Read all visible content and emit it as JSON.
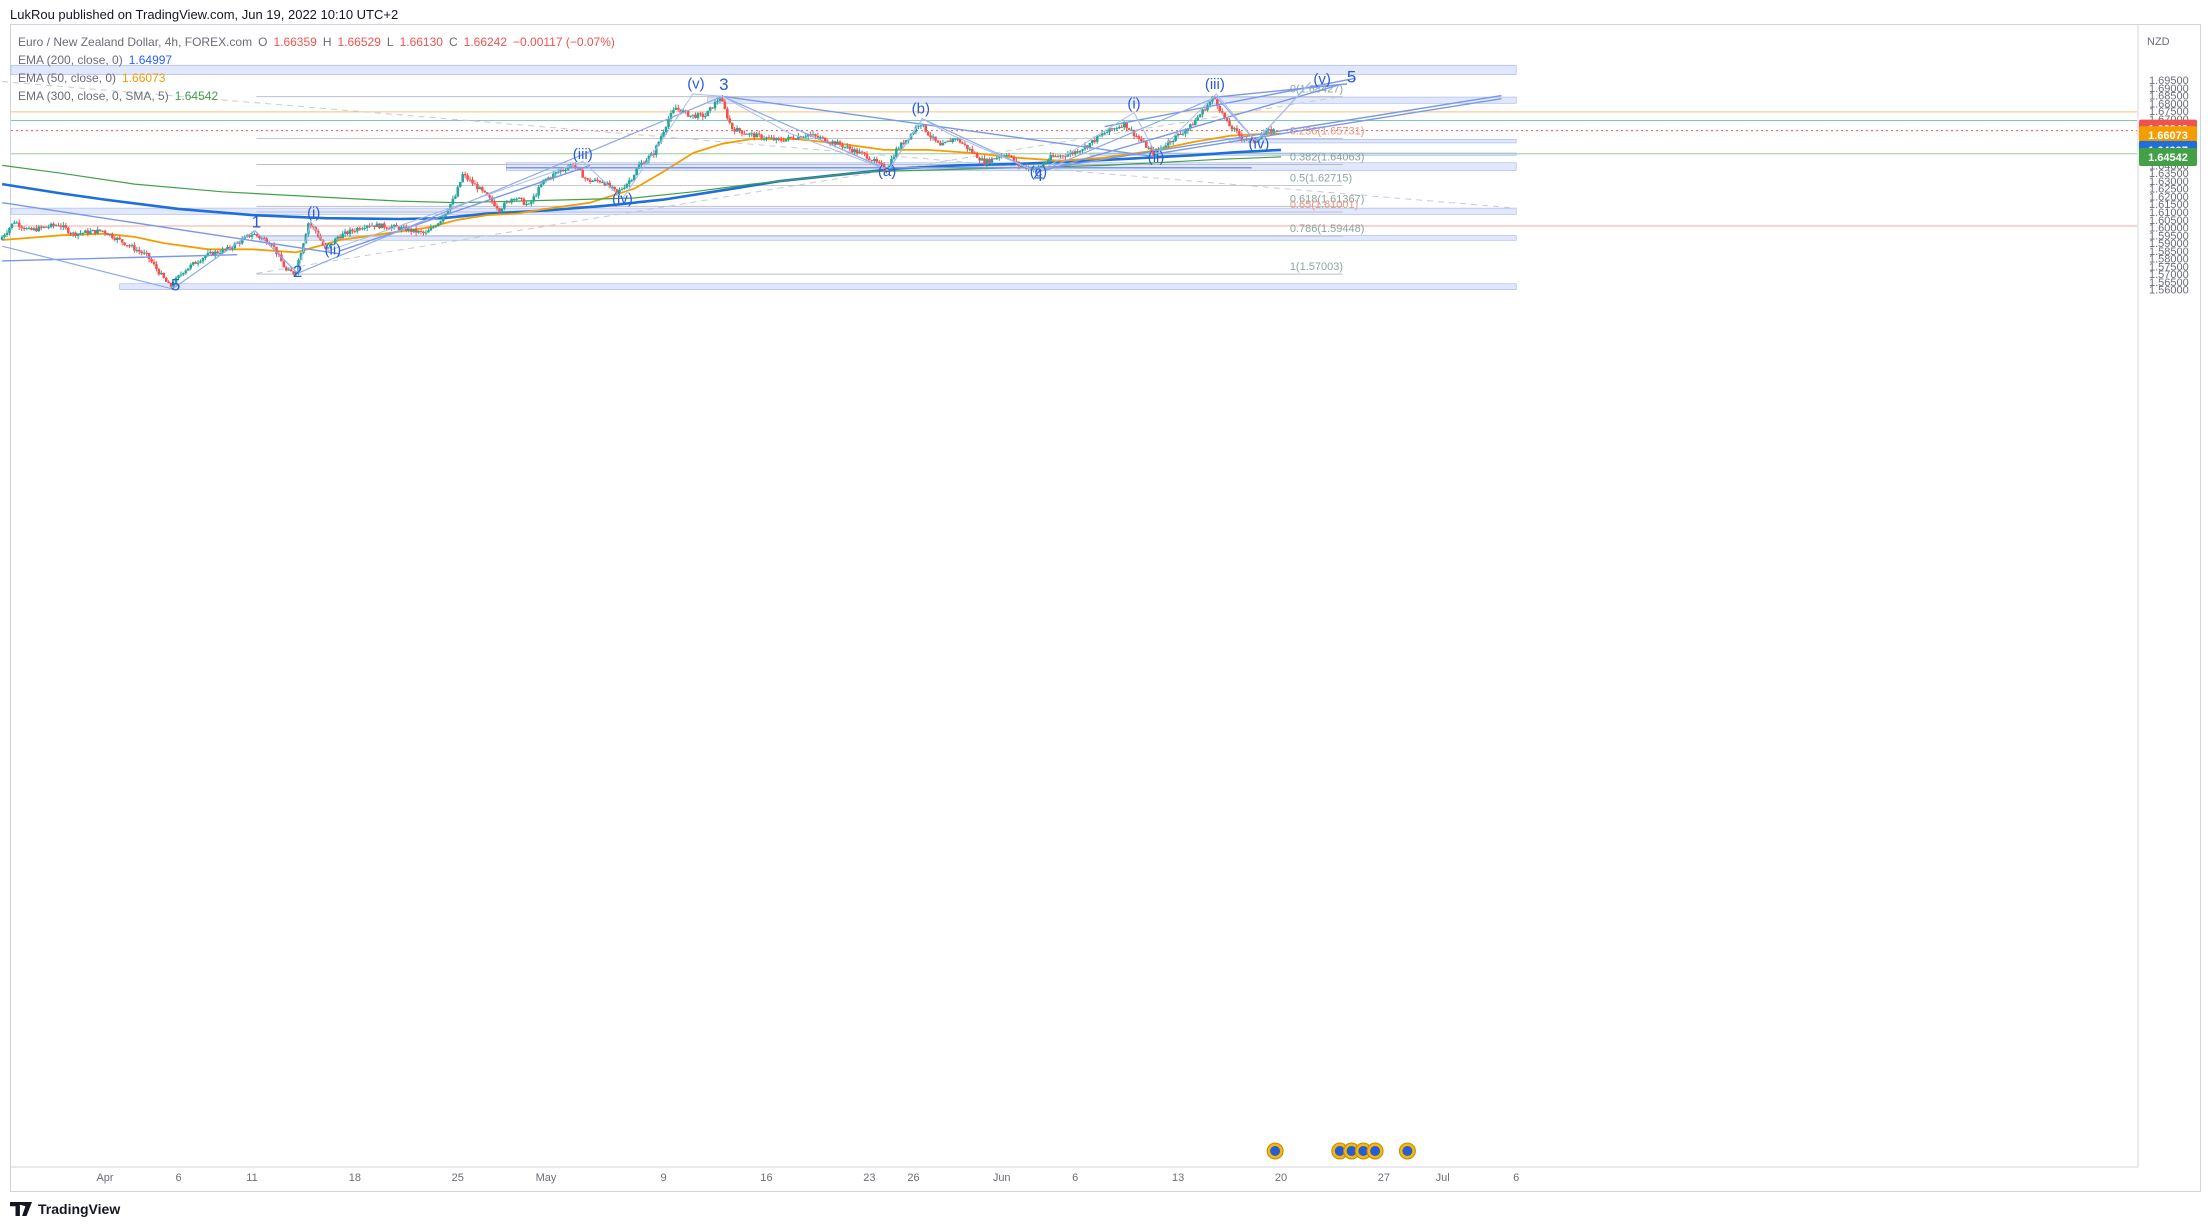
{
  "header": {
    "publisher": "LukRou published on TradingView.com, Jun 19, 2022 10:10 UTC+2"
  },
  "legend": {
    "title": "Euro / New Zealand Dollar, 4h, FOREX.com",
    "ohlc": {
      "o_label": "O",
      "o": "1.66359",
      "h_label": "H",
      "h": "1.66529",
      "l_label": "L",
      "l": "1.66130",
      "c_label": "C",
      "c": "1.66242",
      "change": "−0.00117 (−0.07%)"
    },
    "indicators": [
      {
        "label": "EMA (200, close, 0)",
        "value": "1.64997"
      },
      {
        "label": "EMA (50, close, 0)",
        "value": "1.66073"
      },
      {
        "label": "EMA (300, close, 0, SMA, 5)",
        "value": "1.64542"
      }
    ]
  },
  "footer": {
    "brand": "TradingView"
  },
  "colors": {
    "up": "#26a69a",
    "down": "#ef5350",
    "ema200": "#1e6fd9",
    "ema50": "#f59d00",
    "ema300": "#43a047",
    "zone": "#c9d6fb",
    "wave": "#2a5bd7",
    "trend": "#7a98e8"
  },
  "chart_data": {
    "type": "candlestick",
    "symbol": "Euro / New Zealand Dollar",
    "timeframe": "4h",
    "currency_label": "NZD",
    "ylim": [
      1.5575,
      1.7055
    ],
    "y_ticks": [
      "1.56000",
      "1.56500",
      "1.57000",
      "1.57500",
      "1.58000",
      "1.58500",
      "1.59000",
      "1.59500",
      "1.60000",
      "1.60500",
      "1.61000",
      "1.61500",
      "1.62000",
      "1.62500",
      "1.63000",
      "1.63500",
      "1.64000",
      "1.64500",
      "1.65000",
      "1.65500",
      "1.66000",
      "1.66500",
      "1.67000",
      "1.67500",
      "1.68000",
      "1.68500",
      "1.69000",
      "1.69500"
    ],
    "x_ticks": [
      {
        "label": "Apr",
        "d": 0
      },
      {
        "label": "6",
        "d": 5
      },
      {
        "label": "11",
        "d": 10
      },
      {
        "label": "18",
        "d": 17
      },
      {
        "label": "25",
        "d": 24
      },
      {
        "label": "May",
        "d": 30
      },
      {
        "label": "9",
        "d": 38
      },
      {
        "label": "16",
        "d": 45
      },
      {
        "label": "23",
        "d": 52
      },
      {
        "label": "26",
        "d": 55
      },
      {
        "label": "Jun",
        "d": 61
      },
      {
        "label": "6",
        "d": 66
      },
      {
        "label": "13",
        "d": 73
      },
      {
        "label": "20",
        "d": 80
      },
      {
        "label": "27",
        "d": 87
      },
      {
        "label": "Jul",
        "d": 91
      },
      {
        "label": "6",
        "d": 96
      }
    ],
    "price_path": [
      [
        -7,
        1.592
      ],
      [
        -6,
        1.604
      ],
      [
        -5,
        1.598
      ],
      [
        -3,
        1.602
      ],
      [
        -2,
        1.596
      ],
      [
        0,
        1.598
      ],
      [
        3,
        1.582
      ],
      [
        4.6,
        1.5615
      ],
      [
        5.5,
        1.572
      ],
      [
        7,
        1.582
      ],
      [
        8.5,
        1.586
      ],
      [
        10.2,
        1.596
      ],
      [
        11.5,
        1.59
      ],
      [
        12.5,
        1.572
      ],
      [
        13.1,
        1.5705
      ],
      [
        14,
        1.603
      ],
      [
        14.5,
        1.598
      ],
      [
        15.2,
        1.585
      ],
      [
        16,
        1.594
      ],
      [
        18,
        1.602
      ],
      [
        20,
        1.6
      ],
      [
        22,
        1.596
      ],
      [
        23,
        1.605
      ],
      [
        24,
        1.62
      ],
      [
        24.5,
        1.634
      ],
      [
        25.5,
        1.626
      ],
      [
        27,
        1.612
      ],
      [
        28,
        1.62
      ],
      [
        29,
        1.614
      ],
      [
        30,
        1.63
      ],
      [
        31,
        1.636
      ],
      [
        32,
        1.641
      ],
      [
        33,
        1.63
      ],
      [
        34,
        1.63
      ],
      [
        35,
        1.622
      ],
      [
        36,
        1.632
      ],
      [
        36.5,
        1.64
      ],
      [
        37.5,
        1.648
      ],
      [
        38.5,
        1.67
      ],
      [
        39,
        1.677
      ],
      [
        40,
        1.672
      ],
      [
        41,
        1.672
      ],
      [
        42,
        1.684
      ],
      [
        42.8,
        1.664
      ],
      [
        44,
        1.66
      ],
      [
        46,
        1.656
      ],
      [
        48,
        1.66
      ],
      [
        50,
        1.654
      ],
      [
        52,
        1.646
      ],
      [
        53.3,
        1.6372
      ],
      [
        54,
        1.65
      ],
      [
        55,
        1.66
      ],
      [
        55.6,
        1.668
      ],
      [
        56.2,
        1.66
      ],
      [
        57,
        1.652
      ],
      [
        58,
        1.658
      ],
      [
        59,
        1.65
      ],
      [
        60,
        1.642
      ],
      [
        61.5,
        1.648
      ],
      [
        62.3,
        1.64
      ],
      [
        63.5,
        1.6375
      ],
      [
        64.5,
        1.645
      ],
      [
        66,
        1.648
      ],
      [
        67,
        1.653
      ],
      [
        68,
        1.66
      ],
      [
        69.5,
        1.667
      ],
      [
        70,
        1.662
      ],
      [
        71.5,
        1.6475
      ],
      [
        72.5,
        1.655
      ],
      [
        74,
        1.665
      ],
      [
        75,
        1.677
      ],
      [
        75.6,
        1.684
      ],
      [
        76.5,
        1.667
      ],
      [
        77.5,
        1.658
      ],
      [
        78.3,
        1.6555
      ],
      [
        79,
        1.661
      ],
      [
        79.6,
        1.6624
      ]
    ],
    "series": [
      {
        "name": "EMA (200, close, 0)",
        "last": 1.64997,
        "points": [
          [
            -7,
            1.628
          ],
          [
            -3,
            1.622
          ],
          [
            0,
            1.618
          ],
          [
            5,
            1.612
          ],
          [
            10,
            1.608
          ],
          [
            15,
            1.606
          ],
          [
            20,
            1.6055
          ],
          [
            23,
            1.606
          ],
          [
            26,
            1.609
          ],
          [
            30,
            1.611
          ],
          [
            34,
            1.614
          ],
          [
            38,
            1.618
          ],
          [
            42,
            1.624
          ],
          [
            46,
            1.63
          ],
          [
            50,
            1.634
          ],
          [
            54,
            1.638
          ],
          [
            58,
            1.64
          ],
          [
            62,
            1.641
          ],
          [
            66,
            1.6425
          ],
          [
            70,
            1.6445
          ],
          [
            74,
            1.6465
          ],
          [
            77,
            1.6485
          ],
          [
            80,
            1.65
          ]
        ]
      },
      {
        "name": "EMA (50, close, 0)",
        "last": 1.66073,
        "points": [
          [
            -7,
            1.592
          ],
          [
            -3,
            1.595
          ],
          [
            0,
            1.596
          ],
          [
            2,
            1.594
          ],
          [
            4,
            1.59
          ],
          [
            7,
            1.586
          ],
          [
            10,
            1.586
          ],
          [
            13,
            1.584
          ],
          [
            16,
            1.592
          ],
          [
            19,
            1.596
          ],
          [
            22,
            1.6
          ],
          [
            24,
            1.605
          ],
          [
            26,
            1.608
          ],
          [
            28,
            1.609
          ],
          [
            30,
            1.612
          ],
          [
            33,
            1.616
          ],
          [
            36,
            1.625
          ],
          [
            38,
            1.636
          ],
          [
            40,
            1.648
          ],
          [
            42,
            1.654
          ],
          [
            44,
            1.657
          ],
          [
            47,
            1.657
          ],
          [
            50,
            1.654
          ],
          [
            53,
            1.65
          ],
          [
            56,
            1.65
          ],
          [
            59,
            1.648
          ],
          [
            62,
            1.645
          ],
          [
            65,
            1.643
          ],
          [
            68,
            1.645
          ],
          [
            71,
            1.649
          ],
          [
            74,
            1.655
          ],
          [
            76.5,
            1.659
          ],
          [
            78,
            1.66
          ],
          [
            80,
            1.6605
          ]
        ]
      },
      {
        "name": "EMA (300, close, 0, SMA, 5)",
        "last": 1.64542,
        "points": [
          [
            -7,
            1.64
          ],
          [
            -3,
            1.635
          ],
          [
            2,
            1.628
          ],
          [
            8,
            1.623
          ],
          [
            14,
            1.62
          ],
          [
            20,
            1.617
          ],
          [
            24,
            1.616
          ],
          [
            28,
            1.617
          ],
          [
            32,
            1.618
          ],
          [
            36,
            1.619
          ],
          [
            40,
            1.623
          ],
          [
            44,
            1.628
          ],
          [
            48,
            1.632
          ],
          [
            52,
            1.636
          ],
          [
            56,
            1.637
          ],
          [
            60,
            1.638
          ],
          [
            64,
            1.639
          ],
          [
            68,
            1.64
          ],
          [
            72,
            1.642
          ],
          [
            76,
            1.644
          ],
          [
            80,
            1.6455
          ]
        ]
      }
    ],
    "price_labels": [
      {
        "value": "1.66242",
        "y": 1.66242,
        "color": "#ef5350"
      },
      {
        "value": "1.66073",
        "y": 1.66073,
        "color": "#f59d00"
      },
      {
        "value": "1.64997",
        "y": 1.64997,
        "color": "#1e6fd9"
      },
      {
        "value": "1.64542",
        "y": 1.64542,
        "color": "#43a047"
      }
    ],
    "fib_levels": [
      {
        "label": "0(1.68427)",
        "y": 1.68427
      },
      {
        "label": "0.236(1.65731)",
        "y": 1.65731
      },
      {
        "label": "0.382(1.64063)",
        "y": 1.64063
      },
      {
        "label": "0.5(1.62715)",
        "y": 1.62715
      },
      {
        "label": "0.618(1.61367)",
        "y": 1.61367
      },
      {
        "label": "0.65(1.61001)",
        "y": 1.61001
      },
      {
        "label": "0.786(1.59448)",
        "y": 1.59448
      },
      {
        "label": "1(1.57003)",
        "y": 1.57003
      }
    ],
    "zones": [
      {
        "d1": -7,
        "d2": 96,
        "y1": 1.6985,
        "y2": 1.7045
      },
      {
        "d1": 41,
        "d2": 96,
        "y1": 1.68,
        "y2": 1.684
      },
      {
        "d1": 76.5,
        "d2": 96,
        "y1": 1.6545,
        "y2": 1.6568
      },
      {
        "d1": 67,
        "d2": 96,
        "y1": 1.6465,
        "y2": 1.648
      },
      {
        "d1": 27.3,
        "d2": 96,
        "y1": 1.6367,
        "y2": 1.6417
      },
      {
        "d1": -7,
        "d2": 96,
        "y1": 1.6085,
        "y2": 1.6125
      },
      {
        "d1": 10.5,
        "d2": 96,
        "y1": 1.5918,
        "y2": 1.5948
      },
      {
        "d1": 1,
        "d2": 96,
        "y1": 1.56,
        "y2": 1.5638
      }
    ],
    "wave_labels": [
      {
        "text": "5",
        "d": 4.8,
        "y": 1.5595,
        "big": true
      },
      {
        "text": "1",
        "d": 10.3,
        "y": 1.6,
        "big": true
      },
      {
        "text": "2",
        "d": 13.1,
        "y": 1.568,
        "big": true
      },
      {
        "text": "(i)",
        "d": 14.2,
        "y": 1.6065
      },
      {
        "text": "(ii)",
        "d": 15.5,
        "y": 1.5825
      },
      {
        "text": "(iii)",
        "d": 32.5,
        "y": 1.644
      },
      {
        "text": "(iv)",
        "d": 35.2,
        "y": 1.6155
      },
      {
        "text": "(v)",
        "d": 40.2,
        "y": 1.6895
      },
      {
        "text": "3",
        "d": 42.1,
        "y": 1.6885,
        "big": true
      },
      {
        "text": "(a)",
        "d": 53.2,
        "y": 1.6333
      },
      {
        "text": "(b)",
        "d": 55.5,
        "y": 1.6733
      },
      {
        "text": "(c)",
        "d": 63.5,
        "y": 1.6328
      },
      {
        "text": "4",
        "d": 63.5,
        "y": 1.63,
        "big": true
      },
      {
        "text": "(i)",
        "d": 70.0,
        "y": 1.6768
      },
      {
        "text": "(ii)",
        "d": 71.5,
        "y": 1.6423
      },
      {
        "text": "(iii)",
        "d": 75.5,
        "y": 1.6893
      },
      {
        "text": "(iv)",
        "d": 78.5,
        "y": 1.6508
      },
      {
        "text": "(v)",
        "d": 82.8,
        "y": 1.6925
      },
      {
        "text": "5",
        "d": 84.8,
        "y": 1.6935,
        "big": true
      }
    ],
    "wave_path": [
      [
        -7,
        1.588
      ],
      [
        4.6,
        1.5605
      ],
      [
        10.2,
        1.598
      ],
      [
        13.1,
        1.5705
      ],
      [
        42,
        1.6845
      ],
      [
        53.3,
        1.637
      ],
      [
        55.6,
        1.67
      ],
      [
        63.5,
        1.6355
      ],
      [
        75.6,
        1.684
      ],
      [
        78.3,
        1.6555
      ],
      [
        82,
        1.6935
      ]
    ],
    "sub_waves": [
      [
        [
          13.1,
          1.5705
        ],
        [
          14,
          1.604
        ],
        [
          15.2,
          1.585
        ],
        [
          32.5,
          1.6425
        ],
        [
          35.2,
          1.6185
        ],
        [
          40,
          1.686
        ],
        [
          42,
          1.6845
        ]
      ],
      [
        [
          42,
          1.6845
        ],
        [
          46.5,
          1.661
        ],
        [
          53.3,
          1.637
        ]
      ],
      [
        [
          53.3,
          1.637
        ],
        [
          55.6,
          1.67
        ],
        [
          57.5,
          1.66
        ],
        [
          63.5,
          1.6355
        ]
      ],
      [
        [
          63.5,
          1.6355
        ],
        [
          70,
          1.674
        ],
        [
          71.5,
          1.6475
        ],
        [
          75.6,
          1.686
        ],
        [
          78.3,
          1.6555
        ],
        [
          82,
          1.6935
        ]
      ]
    ],
    "trend_lines": [
      [
        [
          -7,
          1.616
        ],
        [
          16,
          1.583
        ]
      ],
      [
        [
          -7,
          1.5785
        ],
        [
          9,
          1.5825
        ]
      ],
      [
        [
          42,
          1.6845
        ],
        [
          71.5,
          1.6455
        ]
      ],
      [
        [
          71.5,
          1.6475
        ],
        [
          95,
          1.683
        ]
      ],
      [
        [
          64,
          1.638
        ],
        [
          95,
          1.685
        ]
      ],
      [
        [
          75.6,
          1.684
        ],
        [
          84.5,
          1.6925
        ]
      ],
      [
        [
          64,
          1.637
        ],
        [
          84,
          1.692
        ]
      ],
      [
        [
          68,
          1.665
        ],
        [
          85,
          1.696
        ]
      ],
      [
        [
          27.3,
          1.6385
        ],
        [
          78,
          1.6385
        ]
      ],
      [
        [
          16,
          1.585
        ],
        [
          33,
          1.64
        ]
      ]
    ],
    "dashed_lines": [
      [
        [
          10.3,
          1.5705
        ],
        [
          84.2,
          1.6845
        ]
      ],
      [
        [
          -7,
          1.694
        ],
        [
          96,
          1.6125
        ]
      ]
    ],
    "h_lines": [
      {
        "y": 1.6745,
        "color": "#f5c27a"
      },
      {
        "y": 1.6689,
        "color": "#7fc7b8"
      },
      {
        "y": 1.6624,
        "color": "#ef5350",
        "dotted": true
      },
      {
        "y": 1.6475,
        "color": "#9ccc9c"
      },
      {
        "y": 1.601,
        "color": "#f5a99e"
      }
    ],
    "event_icons": [
      {
        "d": 79.6
      },
      {
        "d": 84
      },
      {
        "d": 84.8
      },
      {
        "d": 85.6
      },
      {
        "d": 86.4
      },
      {
        "d": 88.6
      }
    ]
  }
}
